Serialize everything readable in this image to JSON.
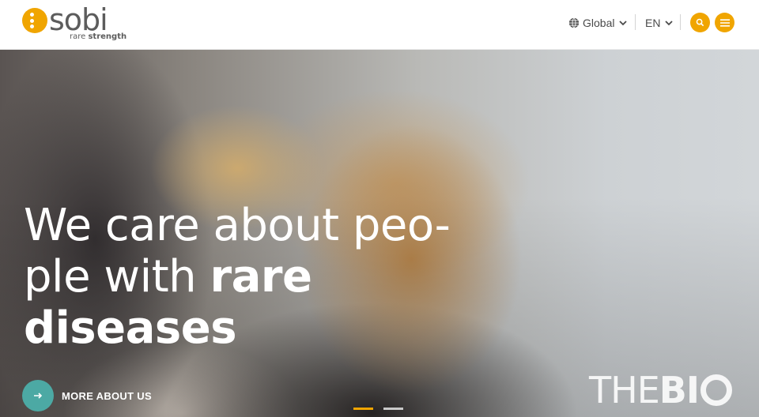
{
  "brand": {
    "name": "sobi",
    "tagline_light": "rare",
    "tagline_bold": "strength",
    "accent": "#f0a500",
    "text_color": "#5c5c5c"
  },
  "header": {
    "region_label": "Global",
    "language_label": "EN",
    "search_icon": "search-icon",
    "menu_icon": "hamburger-menu-icon"
  },
  "hero": {
    "title_light": "We care about peo-ple with ",
    "title_bold": "rare diseases",
    "cta_label": "MORE ABOUT US",
    "cta_color": "#4ca9a4",
    "slides": [
      {
        "active": true
      },
      {
        "active": false
      }
    ]
  },
  "watermark": {
    "light": "THE",
    "bold": "BI"
  }
}
